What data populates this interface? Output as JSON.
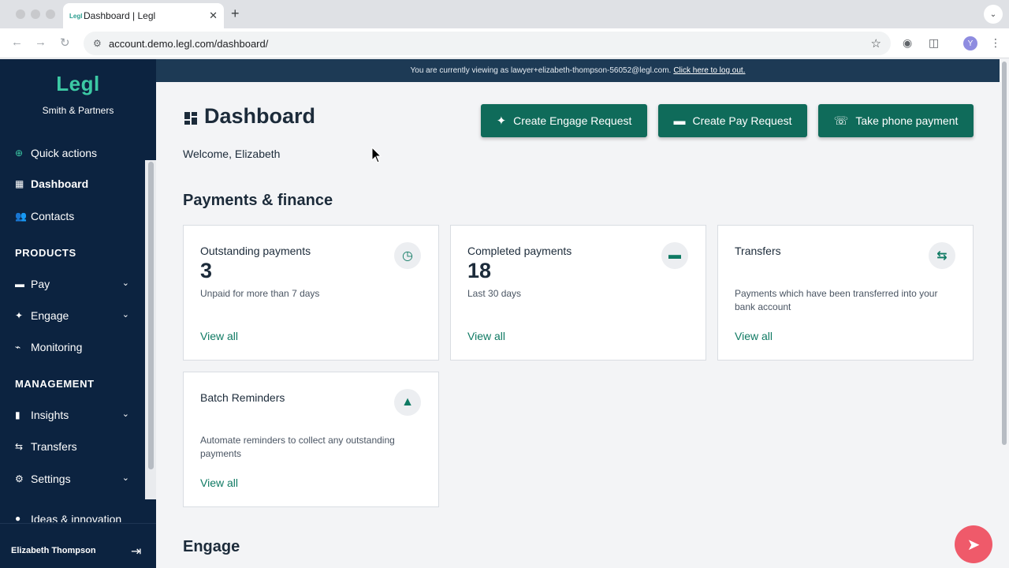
{
  "browser": {
    "tab_title": "Dashboard | Legl",
    "tab_favicon": "Legl",
    "tab_close": "✕",
    "new_tab": "+",
    "url": "account.demo.legl.com/dashboard/",
    "avatar_letter": "Y"
  },
  "banner": {
    "text": "You are currently viewing as lawyer+elizabeth-thompson-56052@legl.com.",
    "link": "Click here to log out."
  },
  "sidebar": {
    "logo": "Legl",
    "firm": "Smith & Partners",
    "items": [
      {
        "label": "Quick actions",
        "icon": "plus-circle-icon"
      },
      {
        "label": "Dashboard",
        "icon": "grid-icon"
      },
      {
        "label": "Contacts",
        "icon": "people-icon"
      },
      {
        "label": "Pay",
        "icon": "wallet-icon"
      },
      {
        "label": "Engage",
        "icon": "handshake-icon"
      },
      {
        "label": "Monitoring",
        "icon": "pulse-icon"
      },
      {
        "label": "Insights",
        "icon": "bar-chart-icon"
      },
      {
        "label": "Transfers",
        "icon": "swap-icon"
      },
      {
        "label": "Settings",
        "icon": "gear-icon"
      },
      {
        "label": "Ideas & innovation",
        "icon": "bulb-icon"
      }
    ],
    "sections": {
      "products": "PRODUCTS",
      "management": "MANAGEMENT"
    },
    "user": "Elizabeth Thompson"
  },
  "header": {
    "title": "Dashboard",
    "welcome": "Welcome, Elizabeth"
  },
  "actions": {
    "engage": "Create Engage Request",
    "pay": "Create Pay Request",
    "phone": "Take phone payment"
  },
  "payments_section": {
    "title": "Payments & finance",
    "cards": [
      {
        "title": "Outstanding payments",
        "value": "3",
        "sub": "Unpaid for more than 7 days",
        "link": "View all",
        "icon": "clock-icon"
      },
      {
        "title": "Completed payments",
        "value": "18",
        "sub": "Last 30 days",
        "link": "View all",
        "icon": "card-icon"
      },
      {
        "title": "Transfers",
        "value": "",
        "sub": "Payments which have been transferred into your bank account",
        "link": "View all",
        "icon": "swap-icon"
      },
      {
        "title": "Batch Reminders",
        "value": "",
        "sub": "Automate reminders to collect any outstanding payments",
        "link": "View all",
        "icon": "warning-icon"
      }
    ]
  },
  "engage_section": {
    "title": "Engage"
  },
  "colors": {
    "sidebar": "#0c2340",
    "accent": "#0f6b5a",
    "logo": "#3cc9a4",
    "fab": "#ef5a6a"
  }
}
